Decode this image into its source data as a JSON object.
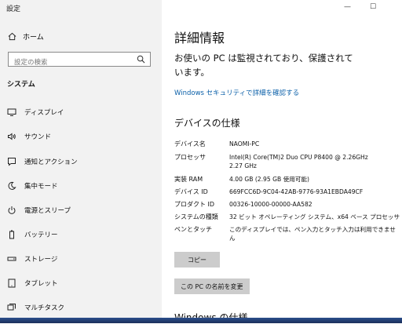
{
  "window": {
    "title": "設定",
    "minimize": "—",
    "maximize": "☐"
  },
  "sidebar": {
    "home_label": "ホーム",
    "search_placeholder": "設定の検索",
    "section_label": "システム",
    "items": [
      {
        "label": "ディスプレイ",
        "icon": "display-icon"
      },
      {
        "label": "サウンド",
        "icon": "sound-icon"
      },
      {
        "label": "通知とアクション",
        "icon": "notification-icon"
      },
      {
        "label": "集中モード",
        "icon": "focus-moon-icon"
      },
      {
        "label": "電源とスリープ",
        "icon": "power-icon"
      },
      {
        "label": "バッテリー",
        "icon": "battery-icon"
      },
      {
        "label": "ストレージ",
        "icon": "storage-icon"
      },
      {
        "label": "タブレット",
        "icon": "tablet-icon"
      },
      {
        "label": "マルチタスク",
        "icon": "multitask-icon"
      }
    ]
  },
  "main": {
    "title": "詳細情報",
    "protection_text": "お使いの PC は監視されており、保護されています。",
    "security_link": "Windows セキュリティで詳細を確認する",
    "device_spec_heading": "デバイスの仕様",
    "specs": [
      {
        "label": "デバイス名",
        "value": "NAOMI-PC"
      },
      {
        "label": "プロセッサ",
        "value": "Intel(R) Core(TM)2 Duo CPU     P8400  @ 2.26GHz\n2.27 GHz"
      },
      {
        "label": "実装 RAM",
        "value": "4.00 GB (2.95 GB 使用可能)"
      },
      {
        "label": "デバイス ID",
        "value": "669FCC6D-9C04-42AB-9776-93A1EBDA49CF"
      },
      {
        "label": "プロダクト ID",
        "value": "00326-10000-00000-AA582"
      },
      {
        "label": "システムの種類",
        "value": "32 ビット オペレーティング システム、x64 ベース プロセッサ"
      },
      {
        "label": "ペンとタッチ",
        "value": "このディスプレイでは、ペン入力とタッチ入力は利用できませ\nん"
      }
    ],
    "copy_button": "コピー",
    "rename_button": "この PC の名前を変更",
    "windows_spec_heading": "Windows の仕様"
  },
  "colors": {
    "sidebar_bg": "#f2f2f2",
    "link": "#0a5fa8",
    "button_bg": "#cccccc"
  }
}
